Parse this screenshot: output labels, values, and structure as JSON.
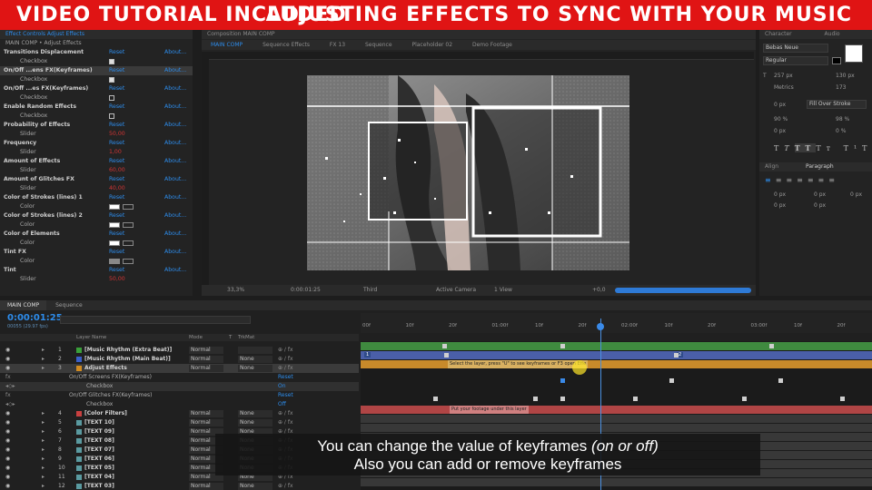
{
  "banner": {
    "left": "VIDEO TUTORIAL INCLUDED",
    "right": "ADJUSTING EFFECTS TO SYNC WITH YOUR MUSIC"
  },
  "effect_controls": {
    "header": "Effect Controls Adjust Effects",
    "breadcrumb": "MAIN COMP • Adjust Effects",
    "reset": "Reset",
    "about": "About...",
    "effects": [
      {
        "name": "Transitions Displacement",
        "sub": "Checkbox",
        "checked": true
      },
      {
        "name": "On/Off ...ens FX(Keyframes)",
        "sub": "Checkbox",
        "checked": true
      },
      {
        "name": "On/Off ...es FX(Keyframes)",
        "sub": "Checkbox",
        "checked": false
      },
      {
        "name": "Enable Random Effects",
        "sub": "Checkbox",
        "checked": false
      },
      {
        "name": "Probability of Effects",
        "sub": "Slider",
        "value": "50,00"
      },
      {
        "name": "Frequency",
        "sub": "Slider",
        "value": "1,00"
      },
      {
        "name": "Amount of Effects",
        "sub": "Slider",
        "value": "60,00"
      },
      {
        "name": "Amount of Glitches FX",
        "sub": "Slider",
        "value": "40,00"
      },
      {
        "name": "Color of Strokes (lines) 1",
        "sub": "Color",
        "color": "#ffffff"
      },
      {
        "name": "Color of Strokes (lines) 2",
        "sub": "Color",
        "color": "#ffffff"
      },
      {
        "name": "Color of Elements",
        "sub": "Color",
        "color": "#ffffff"
      },
      {
        "name": "Tint FX",
        "sub": "Color",
        "color": "#888888"
      },
      {
        "name": "Tint",
        "sub": "Slider",
        "value": "50,00"
      }
    ]
  },
  "viewer": {
    "header": "Composition MAIN COMP",
    "tabs": [
      "MAIN COMP",
      "Sequence Effects",
      "FX 13",
      "Sequence",
      "Placeholder 02",
      "Demo Footage"
    ],
    "zoom": "33,3%",
    "timecode": "0:00:01:25",
    "resolution": "Third",
    "camera": "Active Camera",
    "view": "1 View",
    "exposure": "+0,0"
  },
  "character": {
    "tab1": "Character",
    "tab2": "Audio",
    "font": "Bebas Neue",
    "style": "Regular",
    "size": "257 px",
    "leading": "130 px",
    "kerning": "Metrics",
    "tracking": "173",
    "stroke_width": "0 px",
    "stroke_type": "Fill Over Stroke",
    "vscale": "90 %",
    "hscale": "98 %",
    "baseline": "0 px",
    "tsume": "0 %",
    "align_tab": "Align",
    "paragraph_tab": "Paragraph",
    "indent_values": [
      "0 px",
      "0 px",
      "0 px",
      "0 px",
      "0 px"
    ]
  },
  "timeline": {
    "tabs": [
      "MAIN COMP",
      "Sequence"
    ],
    "timecode": "0:00:01:25",
    "timecode_sub": "00055 (29.97 fps)",
    "columns": {
      "name": "Layer Name",
      "mode": "Mode",
      "t": "T",
      "trkmat": "TrkMat"
    },
    "ruler": [
      "00f",
      "10f",
      "20f",
      "01:00f",
      "10f",
      "20f",
      "02:00f",
      "10f",
      "20f",
      "03:00f",
      "10f",
      "20f"
    ],
    "layers": [
      {
        "num": "1",
        "name": "[Music Rhythm (Extra Beat)]",
        "mode": "Normal",
        "trkmat": "",
        "label": "#3aa03a"
      },
      {
        "num": "2",
        "name": "[Music Rhythm (Main Beat)]",
        "mode": "Normal",
        "trkmat": "None",
        "label": "#3a5fc8"
      },
      {
        "num": "3",
        "name": "Adjust Effects",
        "mode": "Normal",
        "trkmat": "None",
        "label": "#d08a20"
      },
      {
        "num": "4",
        "name": "[Color Filters]",
        "mode": "Normal",
        "trkmat": "None",
        "label": "#c84040"
      },
      {
        "num": "5",
        "name": "[TEXT 10]",
        "mode": "Normal",
        "trkmat": "None",
        "label": "#5a9aa0"
      },
      {
        "num": "6",
        "name": "[TEXT 09]",
        "mode": "Normal",
        "trkmat": "None",
        "label": "#5a9aa0"
      },
      {
        "num": "7",
        "name": "[TEXT 08]",
        "mode": "Normal",
        "trkmat": "None",
        "label": "#5a9aa0"
      },
      {
        "num": "8",
        "name": "[TEXT 07]",
        "mode": "Normal",
        "trkmat": "None",
        "label": "#5a9aa0"
      },
      {
        "num": "9",
        "name": "[TEXT 06]",
        "mode": "Normal",
        "trkmat": "None",
        "label": "#5a9aa0"
      },
      {
        "num": "10",
        "name": "[TEXT 05]",
        "mode": "Normal",
        "trkmat": "None",
        "label": "#5a9aa0"
      },
      {
        "num": "11",
        "name": "[TEXT 04]",
        "mode": "Normal",
        "trkmat": "None",
        "label": "#5a9aa0"
      },
      {
        "num": "12",
        "name": "[TEXT 03]",
        "mode": "Normal",
        "trkmat": "None",
        "label": "#5a9aa0"
      }
    ],
    "props": {
      "screens": "On/Off Screens FX(Keyframes)",
      "glitches": "On/Off Glitches FX(Keyframes)",
      "checkbox": "Checkbox",
      "reset": "Reset",
      "on": "On",
      "off": "Off"
    },
    "bar_notes": {
      "adjust": "Select the layer, press \"U\" to see keyframes or F3 open Effe",
      "color": "Put your footage under this layer"
    },
    "markers": {
      "m1": "1",
      "m2": "2"
    }
  },
  "subtitles": {
    "line1": "You can change the value of keyframes",
    "line1_italic": "(on or off)",
    "line2": "Also you can add or remove keyframes"
  },
  "colors": {
    "banner": "#e01414",
    "accent_blue": "#2d8ceb",
    "reset_blue": "#2d8ceb",
    "value_red": "#d03434"
  }
}
